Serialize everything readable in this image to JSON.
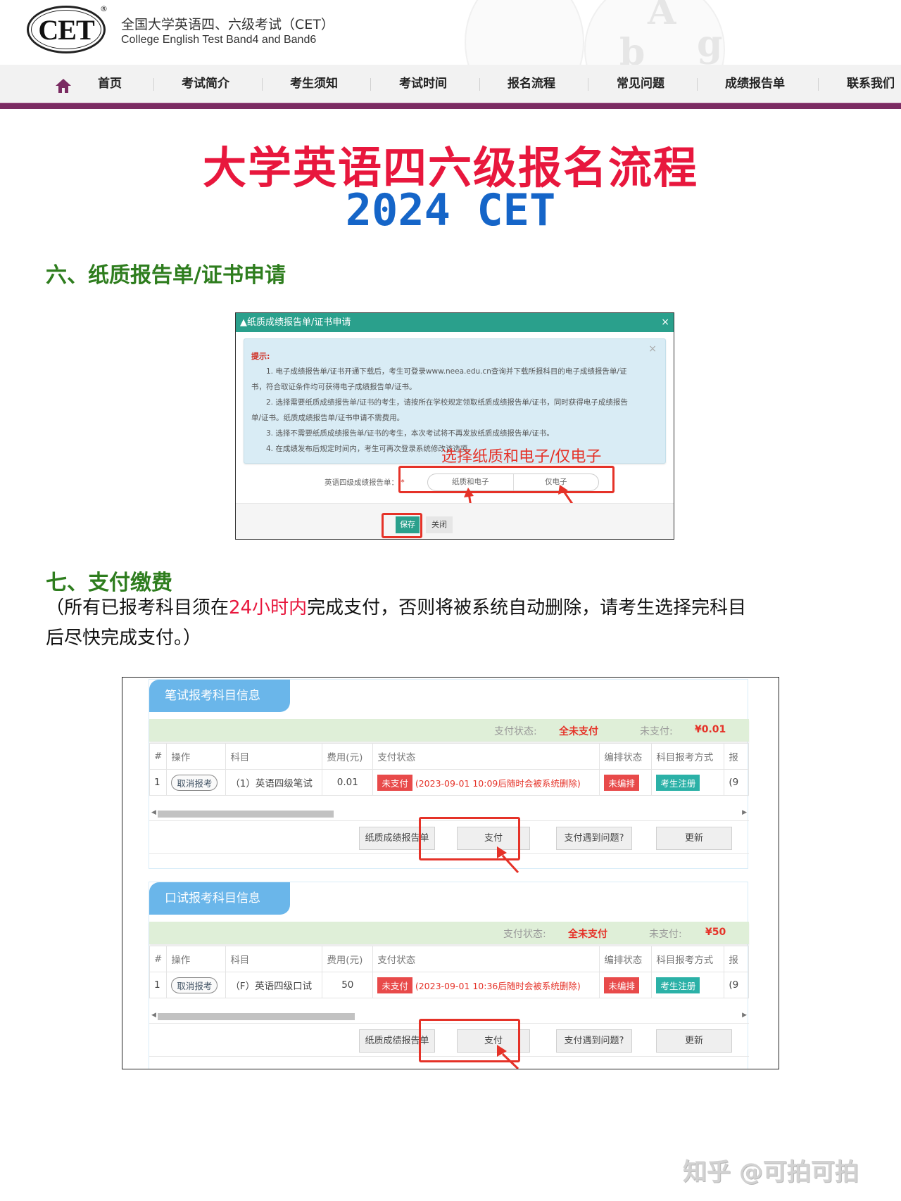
{
  "header": {
    "logo_text": "CET",
    "logo_reg": "®",
    "title_cn": "全国大学英语四、六级考试（CET）",
    "title_en": "College English Test Band4 and Band6",
    "deco_letters": [
      "A",
      "g",
      "b"
    ]
  },
  "nav": {
    "home_icon": "home-icon",
    "items": [
      "首页",
      "考试简介",
      "考生须知",
      "考试时间",
      "报名流程",
      "常见问题",
      "成绩报告单",
      "联系我们"
    ]
  },
  "page": {
    "title": "大学英语四六级报名流程",
    "subtitle": "2024 CET"
  },
  "section6": {
    "heading": "六、纸质报告单/证书申请",
    "dialog": {
      "title": "▲纸质成绩报告单/证书申请",
      "close": "×",
      "tip_close": "×",
      "tip_label": "提示:",
      "tip_lines": [
        "　　1. 电子成绩报告单/证书开通下载后，考生可登录www.neea.edu.cn查询并下载所报科目的电子成绩报告单/证",
        "书，符合取证条件均可获得电子成绩报告单/证书。",
        "　　2. 选择需要纸质成绩报告单/证书的考生，请按所在学校规定领取纸质成绩报告单/证书，同时获得电子成绩报告",
        "单/证书。纸质成绩报告单/证书申请不需费用。",
        "　　3. 选择不需要纸质成绩报告单/证书的考生，本次考试将不再发放纸质成绩报告单/证书。",
        "　　4. 在成绩发布后规定时间内，考生可再次登录系统修改该选项。"
      ],
      "annotation": "选择纸质和电子/仅电子",
      "report_label": "英语四级成绩报告单：",
      "required_mark": "*",
      "options": [
        "纸质和电子",
        "仅电子"
      ],
      "save_label": "保存",
      "close_label": "关闭"
    }
  },
  "section7": {
    "heading": "七、支付缴费",
    "note_before": "（所有已报考科目须在",
    "note_highlight": "24小时内",
    "note_after": "完成支付，否则将被系统自动删除，请考生选择完科目",
    "note_line2": "后尽快完成支付。）"
  },
  "payment": {
    "columns": [
      "#",
      "操作",
      "科目",
      "费用(元)",
      "支付状态",
      "编排状态",
      "科目报考方式",
      "报"
    ],
    "summary_status_label": "支付状态:",
    "summary_unpaid_label": "未支付:",
    "buttons": [
      "纸质成绩报告单",
      "支付",
      "支付遇到问题?",
      "更新"
    ],
    "panels": [
      {
        "tab": "笔试报考科目信息",
        "summary_status": "全未支付",
        "summary_unpaid": "¥0.01",
        "rows": [
          {
            "index": "1",
            "action": "取消报考",
            "subject": "（1）英语四级笔试",
            "fee": "0.01",
            "pay_tag": "未支付",
            "pay_note": "(2023-09-01 10:09后随时会被系统删除)",
            "arrange": "未编排",
            "method": "考生注册",
            "extra": "(9"
          }
        ]
      },
      {
        "tab": "口试报考科目信息",
        "summary_status": "全未支付",
        "summary_unpaid": "¥50",
        "rows": [
          {
            "index": "1",
            "action": "取消报考",
            "subject": "（F）英语四级口试",
            "fee": "50",
            "pay_tag": "未支付",
            "pay_note": "(2023-09-01 10:36后随时会被系统删除)",
            "arrange": "未编排",
            "method": "考生注册",
            "extra": "(9"
          }
        ]
      }
    ]
  },
  "watermark": "知乎 @可拍可拍",
  "colors": {
    "title_red": "#e8173d",
    "subtitle_blue": "#1565c8",
    "section_green": "#2e7d1e",
    "nav_purple": "#7a2b62",
    "dialog_teal": "#2aa08c",
    "annotation_red": "#e53228",
    "tab_blue": "#6ab6ea"
  }
}
